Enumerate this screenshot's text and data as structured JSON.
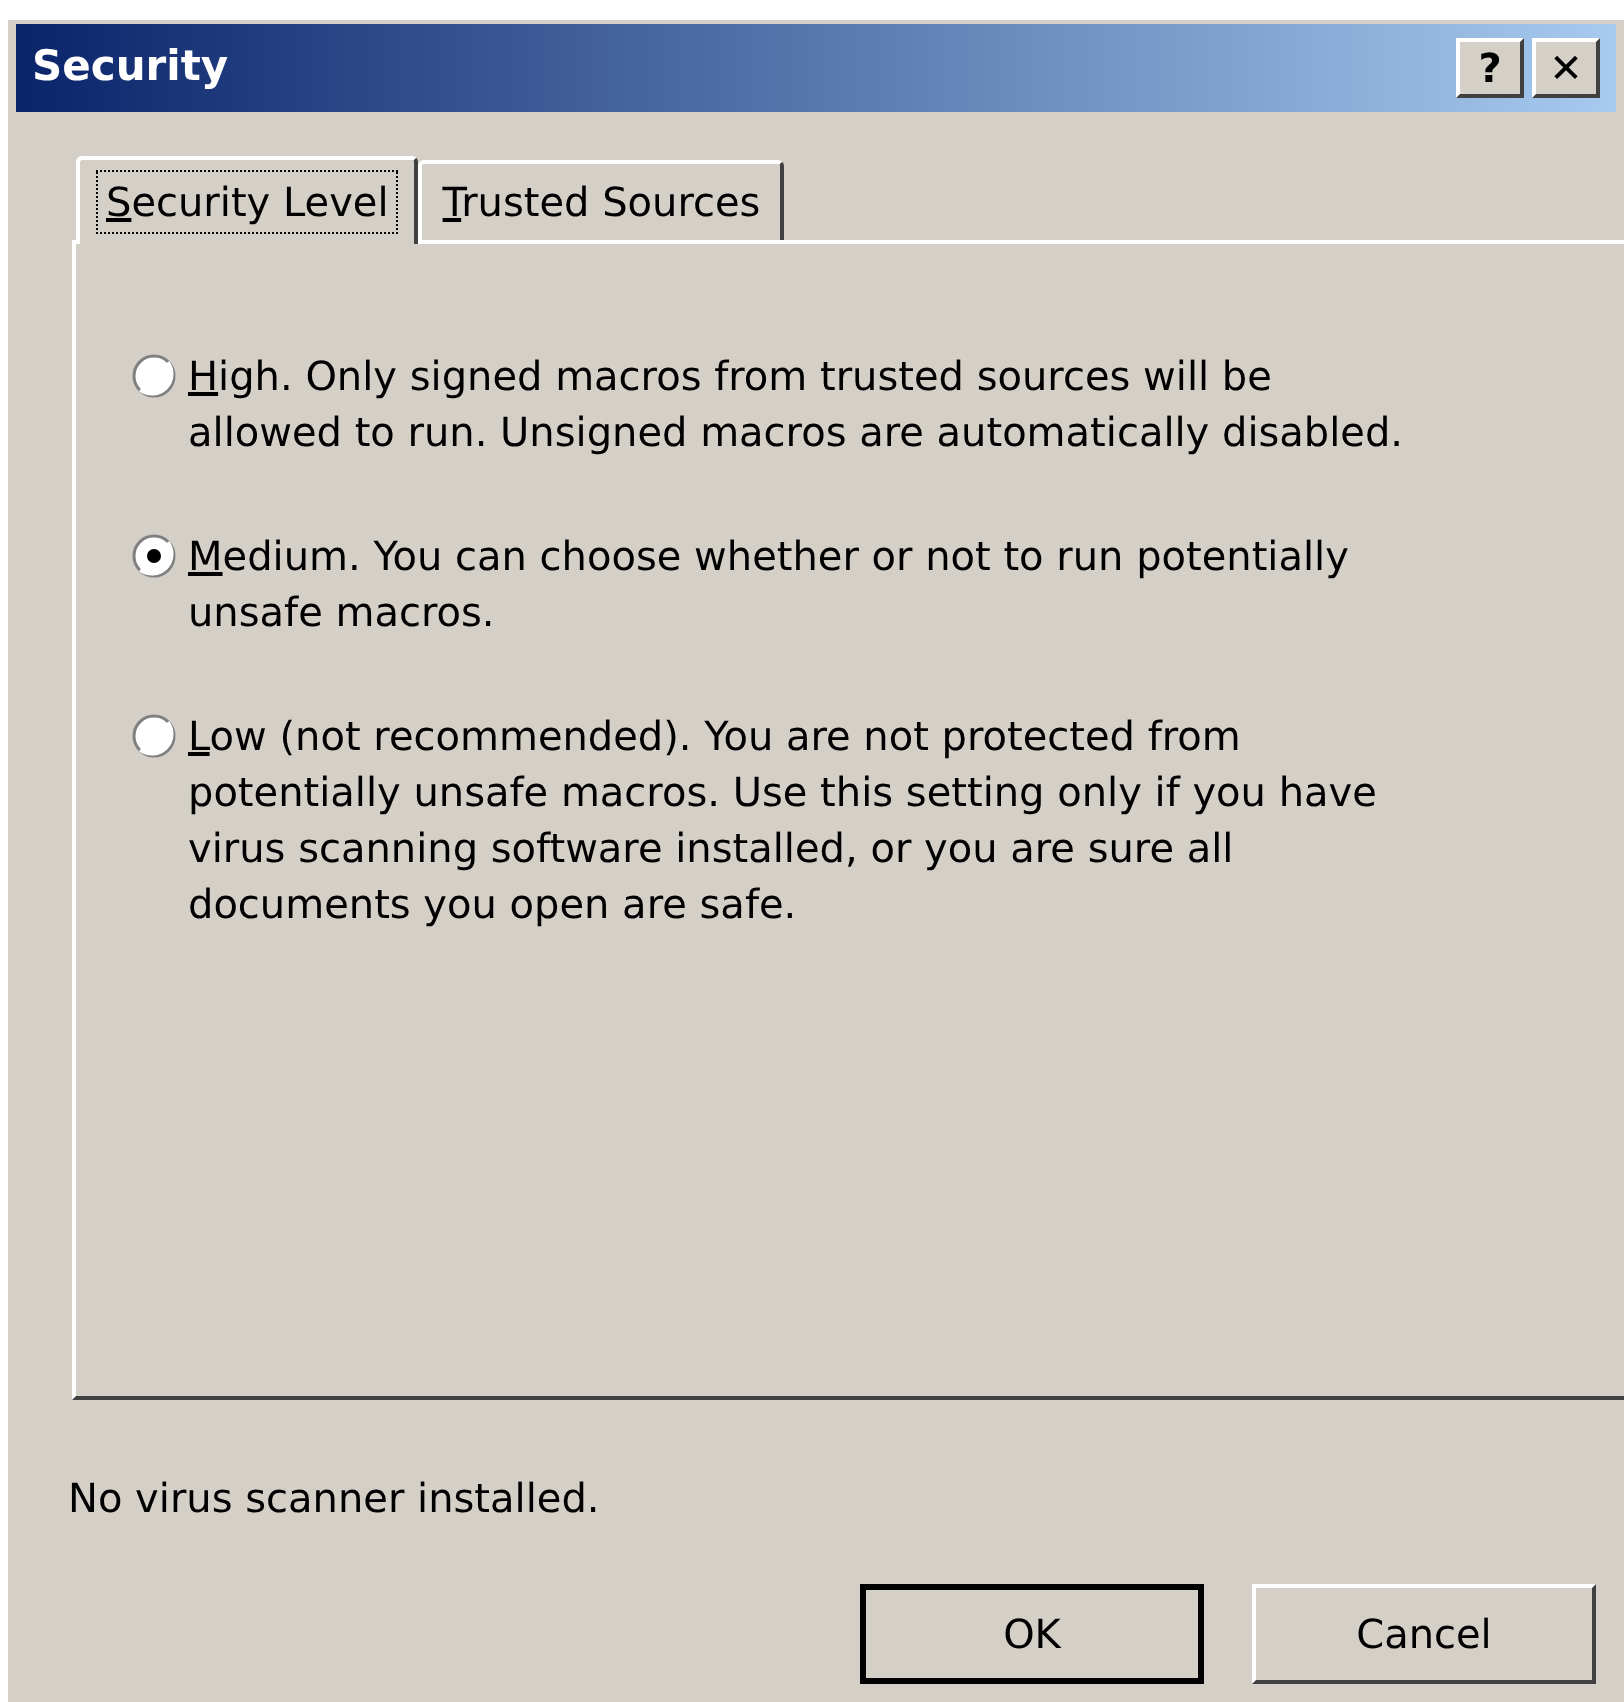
{
  "window": {
    "title": "Security",
    "buttons": [
      "?",
      "✕"
    ]
  },
  "tabs": [
    {
      "label": "Security Level",
      "selected": true
    },
    {
      "label": "Trusted Sources",
      "selected": false
    }
  ],
  "options": [
    {
      "label": "High. Only signed macros from trusted sources will be allowed to run. Unsigned macros are automatically disabled.",
      "selected": false
    },
    {
      "label": "Medium. You can choose whether or not to run potentially unsafe macros.",
      "selected": true
    },
    {
      "label": "Low (not recommended). You are not protected from potentially unsafe macros. Use this setting only if you have virus scanning software installed, or you are sure all documents you open are safe.",
      "selected": false
    }
  ],
  "status": "No virus scanner installed.",
  "buttons": [
    "OK",
    "Cancel"
  ]
}
